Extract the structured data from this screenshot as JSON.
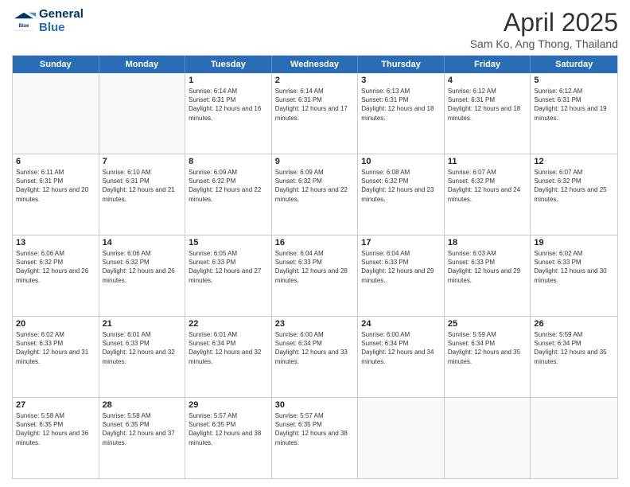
{
  "header": {
    "logo_general": "General",
    "logo_blue": "Blue",
    "month_title": "April 2025",
    "subtitle": "Sam Ko, Ang Thong, Thailand"
  },
  "weekdays": [
    "Sunday",
    "Monday",
    "Tuesday",
    "Wednesday",
    "Thursday",
    "Friday",
    "Saturday"
  ],
  "rows": [
    [
      {
        "day": "",
        "sunrise": "",
        "sunset": "",
        "daylight": "",
        "empty": true
      },
      {
        "day": "",
        "sunrise": "",
        "sunset": "",
        "daylight": "",
        "empty": true
      },
      {
        "day": "1",
        "sunrise": "Sunrise: 6:14 AM",
        "sunset": "Sunset: 6:31 PM",
        "daylight": "Daylight: 12 hours and 16 minutes.",
        "empty": false
      },
      {
        "day": "2",
        "sunrise": "Sunrise: 6:14 AM",
        "sunset": "Sunset: 6:31 PM",
        "daylight": "Daylight: 12 hours and 17 minutes.",
        "empty": false
      },
      {
        "day": "3",
        "sunrise": "Sunrise: 6:13 AM",
        "sunset": "Sunset: 6:31 PM",
        "daylight": "Daylight: 12 hours and 18 minutes.",
        "empty": false
      },
      {
        "day": "4",
        "sunrise": "Sunrise: 6:12 AM",
        "sunset": "Sunset: 6:31 PM",
        "daylight": "Daylight: 12 hours and 18 minutes.",
        "empty": false
      },
      {
        "day": "5",
        "sunrise": "Sunrise: 6:12 AM",
        "sunset": "Sunset: 6:31 PM",
        "daylight": "Daylight: 12 hours and 19 minutes.",
        "empty": false
      }
    ],
    [
      {
        "day": "6",
        "sunrise": "Sunrise: 6:11 AM",
        "sunset": "Sunset: 6:31 PM",
        "daylight": "Daylight: 12 hours and 20 minutes.",
        "empty": false
      },
      {
        "day": "7",
        "sunrise": "Sunrise: 6:10 AM",
        "sunset": "Sunset: 6:31 PM",
        "daylight": "Daylight: 12 hours and 21 minutes.",
        "empty": false
      },
      {
        "day": "8",
        "sunrise": "Sunrise: 6:09 AM",
        "sunset": "Sunset: 6:32 PM",
        "daylight": "Daylight: 12 hours and 22 minutes.",
        "empty": false
      },
      {
        "day": "9",
        "sunrise": "Sunrise: 6:09 AM",
        "sunset": "Sunset: 6:32 PM",
        "daylight": "Daylight: 12 hours and 22 minutes.",
        "empty": false
      },
      {
        "day": "10",
        "sunrise": "Sunrise: 6:08 AM",
        "sunset": "Sunset: 6:32 PM",
        "daylight": "Daylight: 12 hours and 23 minutes.",
        "empty": false
      },
      {
        "day": "11",
        "sunrise": "Sunrise: 6:07 AM",
        "sunset": "Sunset: 6:32 PM",
        "daylight": "Daylight: 12 hours and 24 minutes.",
        "empty": false
      },
      {
        "day": "12",
        "sunrise": "Sunrise: 6:07 AM",
        "sunset": "Sunset: 6:32 PM",
        "daylight": "Daylight: 12 hours and 25 minutes.",
        "empty": false
      }
    ],
    [
      {
        "day": "13",
        "sunrise": "Sunrise: 6:06 AM",
        "sunset": "Sunset: 6:32 PM",
        "daylight": "Daylight: 12 hours and 26 minutes.",
        "empty": false
      },
      {
        "day": "14",
        "sunrise": "Sunrise: 6:06 AM",
        "sunset": "Sunset: 6:32 PM",
        "daylight": "Daylight: 12 hours and 26 minutes.",
        "empty": false
      },
      {
        "day": "15",
        "sunrise": "Sunrise: 6:05 AM",
        "sunset": "Sunset: 6:33 PM",
        "daylight": "Daylight: 12 hours and 27 minutes.",
        "empty": false
      },
      {
        "day": "16",
        "sunrise": "Sunrise: 6:04 AM",
        "sunset": "Sunset: 6:33 PM",
        "daylight": "Daylight: 12 hours and 28 minutes.",
        "empty": false
      },
      {
        "day": "17",
        "sunrise": "Sunrise: 6:04 AM",
        "sunset": "Sunset: 6:33 PM",
        "daylight": "Daylight: 12 hours and 29 minutes.",
        "empty": false
      },
      {
        "day": "18",
        "sunrise": "Sunrise: 6:03 AM",
        "sunset": "Sunset: 6:33 PM",
        "daylight": "Daylight: 12 hours and 29 minutes.",
        "empty": false
      },
      {
        "day": "19",
        "sunrise": "Sunrise: 6:02 AM",
        "sunset": "Sunset: 6:33 PM",
        "daylight": "Daylight: 12 hours and 30 minutes.",
        "empty": false
      }
    ],
    [
      {
        "day": "20",
        "sunrise": "Sunrise: 6:02 AM",
        "sunset": "Sunset: 6:33 PM",
        "daylight": "Daylight: 12 hours and 31 minutes.",
        "empty": false
      },
      {
        "day": "21",
        "sunrise": "Sunrise: 6:01 AM",
        "sunset": "Sunset: 6:33 PM",
        "daylight": "Daylight: 12 hours and 32 minutes.",
        "empty": false
      },
      {
        "day": "22",
        "sunrise": "Sunrise: 6:01 AM",
        "sunset": "Sunset: 6:34 PM",
        "daylight": "Daylight: 12 hours and 32 minutes.",
        "empty": false
      },
      {
        "day": "23",
        "sunrise": "Sunrise: 6:00 AM",
        "sunset": "Sunset: 6:34 PM",
        "daylight": "Daylight: 12 hours and 33 minutes.",
        "empty": false
      },
      {
        "day": "24",
        "sunrise": "Sunrise: 6:00 AM",
        "sunset": "Sunset: 6:34 PM",
        "daylight": "Daylight: 12 hours and 34 minutes.",
        "empty": false
      },
      {
        "day": "25",
        "sunrise": "Sunrise: 5:59 AM",
        "sunset": "Sunset: 6:34 PM",
        "daylight": "Daylight: 12 hours and 35 minutes.",
        "empty": false
      },
      {
        "day": "26",
        "sunrise": "Sunrise: 5:59 AM",
        "sunset": "Sunset: 6:34 PM",
        "daylight": "Daylight: 12 hours and 35 minutes.",
        "empty": false
      }
    ],
    [
      {
        "day": "27",
        "sunrise": "Sunrise: 5:58 AM",
        "sunset": "Sunset: 6:35 PM",
        "daylight": "Daylight: 12 hours and 36 minutes.",
        "empty": false
      },
      {
        "day": "28",
        "sunrise": "Sunrise: 5:58 AM",
        "sunset": "Sunset: 6:35 PM",
        "daylight": "Daylight: 12 hours and 37 minutes.",
        "empty": false
      },
      {
        "day": "29",
        "sunrise": "Sunrise: 5:57 AM",
        "sunset": "Sunset: 6:35 PM",
        "daylight": "Daylight: 12 hours and 38 minutes.",
        "empty": false
      },
      {
        "day": "30",
        "sunrise": "Sunrise: 5:57 AM",
        "sunset": "Sunset: 6:35 PM",
        "daylight": "Daylight: 12 hours and 38 minutes.",
        "empty": false
      },
      {
        "day": "",
        "sunrise": "",
        "sunset": "",
        "daylight": "",
        "empty": true
      },
      {
        "day": "",
        "sunrise": "",
        "sunset": "",
        "daylight": "",
        "empty": true
      },
      {
        "day": "",
        "sunrise": "",
        "sunset": "",
        "daylight": "",
        "empty": true
      }
    ]
  ]
}
